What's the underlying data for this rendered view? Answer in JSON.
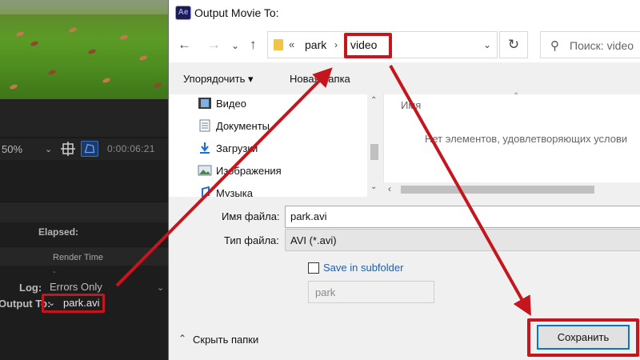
{
  "ae_panel": {
    "zoom": "50%",
    "timecode": "0:00:06:21",
    "elapsed_label": "Elapsed:",
    "render_time_header": "Render Time",
    "render_time_value": "-",
    "log_label": "Log:",
    "log_value": "Errors Only",
    "output_label": "Output To:",
    "output_file": "park.avi"
  },
  "dialog": {
    "app_icon_text": "Ae",
    "title": "Output Movie To:",
    "path": {
      "separator": "«",
      "parent": "park",
      "current": "video"
    },
    "search_placeholder": "Поиск: video",
    "toolbar": {
      "organize": "Упорядочить ▾",
      "new_folder": "Новая папка"
    },
    "nav_items": [
      "Видео",
      "Документы",
      "Загрузки",
      "Изображения",
      "Музыка"
    ],
    "column_name": "Имя",
    "empty_message": "Нет элементов, удовлетворяющих услови",
    "filename_label": "Имя файла:",
    "filename_value": "park.avi",
    "filetype_label": "Тип файла:",
    "filetype_value": "AVI (*.avi)",
    "subfolder_label": "Save in subfolder",
    "subfolder_checked": false,
    "subfolder_value": "park",
    "hide_folders": "Скрыть папки",
    "save_button": "Сохранить"
  },
  "colors": {
    "highlight": "#c4161c",
    "accent": "#0078d7"
  }
}
